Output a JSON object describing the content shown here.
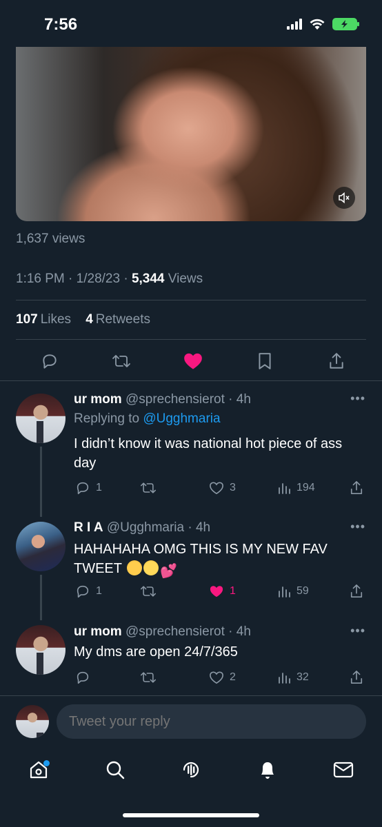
{
  "status": {
    "time": "7:56"
  },
  "tweet": {
    "video_views": "1,637 views",
    "time": "1:16 PM",
    "date": "1/28/23",
    "views_count": "5,344",
    "views_label": "Views",
    "likes_count": "107",
    "likes_label": "Likes",
    "retweets_count": "4",
    "retweets_label": "Retweets",
    "liked": true
  },
  "replies": [
    {
      "name": "ur mom",
      "handle": "@sprechensierot",
      "time": "4h",
      "replying_prefix": "Replying to",
      "replying_to": "@Ugghmaria",
      "text": "I didn’t know it was national hot piece of ass day",
      "reply_count": "1",
      "retweet_count": "",
      "like_count": "3",
      "view_count": "194"
    },
    {
      "name": "R I A",
      "handle": "@Ugghmaria",
      "time": "4h",
      "text": "HAHAHAHA OMG THIS IS MY NEW FAV TWEET",
      "emoji": [
        "crying-face",
        "laughing-face",
        "two-hearts"
      ],
      "reply_count": "1",
      "retweet_count": "",
      "like_count": "1",
      "liked": true,
      "view_count": "59"
    },
    {
      "name": "ur mom",
      "handle": "@sprechensierot",
      "time": "4h",
      "text": "My dms are open 24/7/365",
      "reply_count": "",
      "retweet_count": "",
      "like_count": "2",
      "view_count": "32"
    }
  ],
  "compose": {
    "placeholder": "Tweet your reply"
  },
  "colors": {
    "background": "#15202b",
    "accent": "#1d9bf0",
    "like": "#f91880",
    "muted": "#8b98a5"
  },
  "icons": [
    "reply-icon",
    "retweet-icon",
    "like-icon",
    "bookmark-icon",
    "share-icon",
    "views-icon",
    "home-icon",
    "search-icon",
    "spaces-icon",
    "notifications-icon",
    "messages-icon",
    "mute-icon"
  ]
}
